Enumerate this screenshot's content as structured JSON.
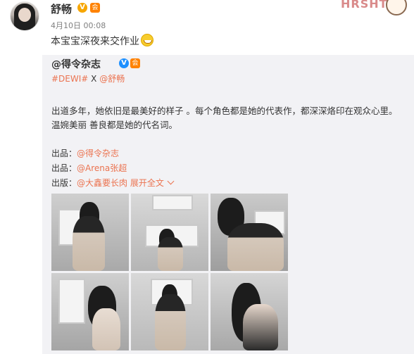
{
  "post": {
    "author": "舒畅",
    "verified_badge": "V",
    "level_badge": "会",
    "timestamp": "4月10日 00:08",
    "text": "本宝宝深夜来交作业",
    "emoji": "smile-emoji"
  },
  "sticker": {
    "text": "HRSHT"
  },
  "repost": {
    "author": "@得令杂志",
    "verified_badge": "V",
    "level_badge": "会",
    "hashtag": "#DEWI#",
    "separator": "X",
    "mention": "@舒畅",
    "body": "出道多年，她依旧是最美好的样子 。每个角色都是她的代表作，都深深烙印在观众心里。温婉美丽 善良都是她的代名词。",
    "credits": [
      {
        "label": "出品：",
        "value": "@得令杂志"
      },
      {
        "label": "出品：",
        "value": "@Arena张超"
      },
      {
        "label": "出版：",
        "value": "@大鑫要长肉"
      }
    ],
    "expand_label": "展开全文",
    "photos": [
      {
        "name": "photo-1"
      },
      {
        "name": "photo-2"
      },
      {
        "name": "photo-3"
      },
      {
        "name": "photo-4"
      },
      {
        "name": "photo-5"
      },
      {
        "name": "photo-6"
      }
    ]
  },
  "colors": {
    "link": "#eb7350",
    "repost_bg": "#f2f2f5",
    "verified_gold": "#f7a600",
    "verified_blue": "#1e90ff"
  }
}
